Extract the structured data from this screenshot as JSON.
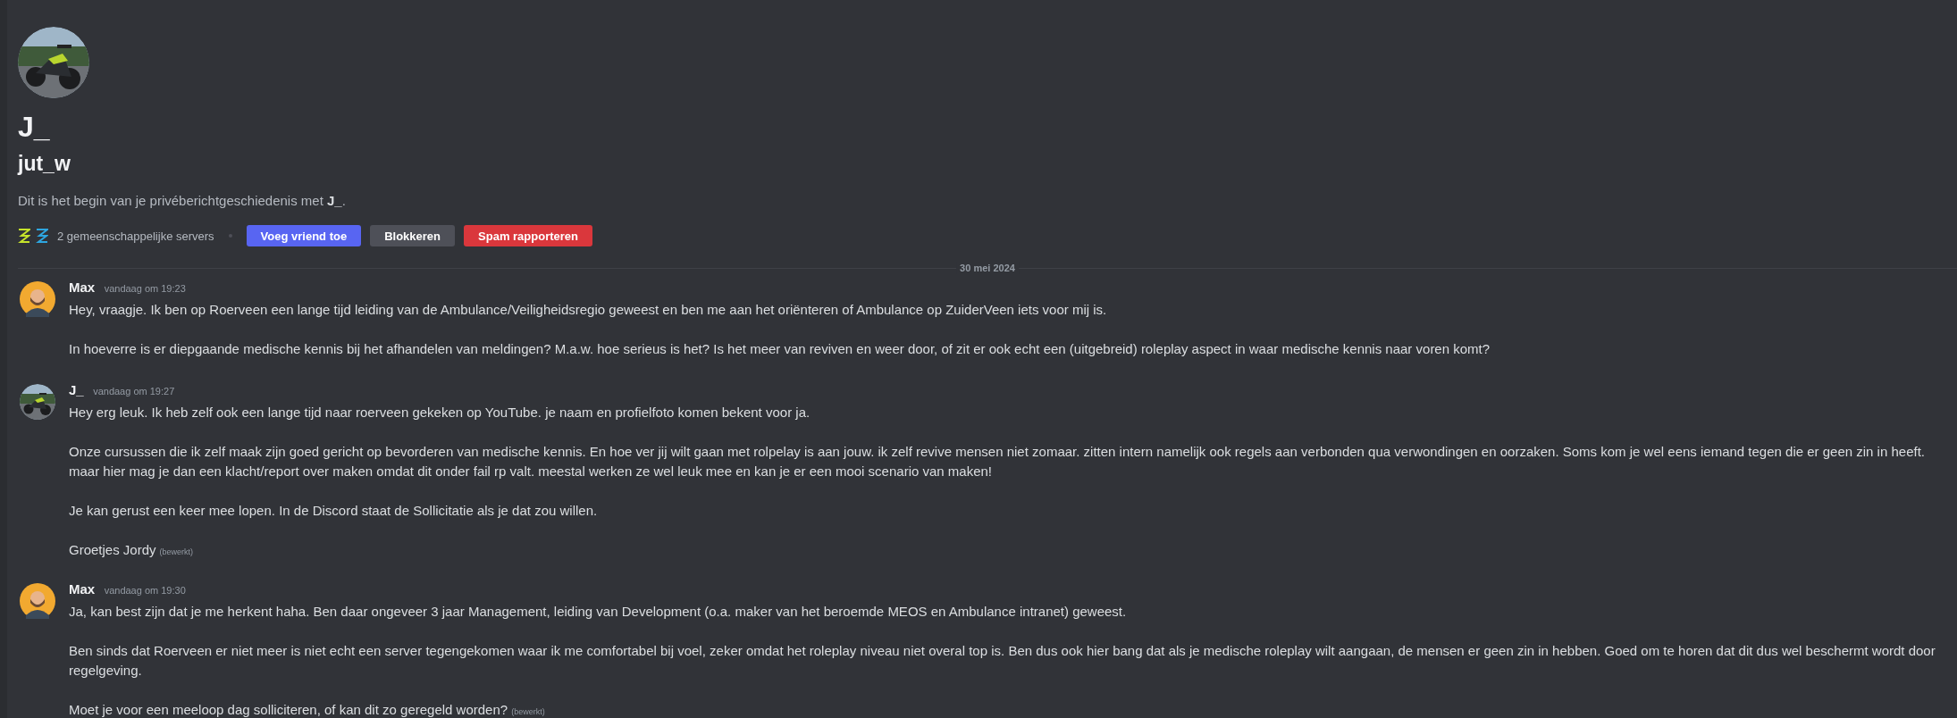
{
  "profile": {
    "display_name": "J_",
    "username": "jut_w",
    "intro": "Dit is het begin van je privéberichtgeschiedenis met **J_**.",
    "server_icons": [
      {
        "color": "#c6e32b"
      },
      {
        "color": "#2ea6e0"
      }
    ],
    "mutual_servers": "2 gemeenschappelijke servers",
    "buttons": [
      {
        "label": "Voeg vriend toe",
        "kind": "primary"
      },
      {
        "label": "Blokkeren",
        "kind": "secondary"
      },
      {
        "label": "Spam rapporteren",
        "kind": "danger"
      }
    ]
  },
  "date_divider": "30 mei 2024",
  "messages": [
    {
      "author": "Max",
      "time": "vandaag om 19:23",
      "avatar": {
        "kind": "figure"
      },
      "paragraphs": [
        {
          "text": "Hey, vraagje. Ik ben op Roerveen een lange tijd leiding van de Ambulance/Veiligheidsregio geweest en ben me aan het oriënteren of Ambulance op ZuiderVeen iets voor mij is."
        },
        {
          "text": "In hoeverre is er diepgaande medische kennis bij het afhandelen van meldingen? M.a.w. hoe serieus is het? Is het meer van reviven en weer door, of zit er ook echt een (uitgebreid) roleplay aspect in waar medische kennis naar voren komt?"
        }
      ]
    },
    {
      "author": "J_",
      "time": "vandaag om 19:27",
      "paragraphs": [
        {
          "text": "Hey erg leuk. Ik heb zelf ook een lange tijd naar roerveen gekeken op YouTube. je naam en profielfoto komen bekent voor ja."
        },
        {
          "text": "Onze cursussen die ik zelf maak zijn goed gericht op bevorderen van medische kennis. En hoe ver jij wilt gaan met rolpelay is aan jouw. ik zelf revive mensen niet zomaar. zitten intern namelijk ook regels aan verbonden qua verwondingen en oorzaken. Soms kom je wel eens iemand tegen die er geen zin in heeft. maar hier mag je dan een klacht/report over maken omdat dit onder fail rp valt. meestal werken ze wel leuk mee en kan je er een mooi scenario van maken!"
        },
        {
          "text": "Je kan gerust een keer mee lopen. In de Discord staat de Sollicitatie als je dat zou willen."
        },
        {
          "text": "Groetjes Jordy",
          "edited": "(bewerkt)"
        }
      ]
    },
    {
      "author": "Max",
      "time": "vandaag om 19:30",
      "avatar": {
        "kind": "figure"
      },
      "paragraphs": [
        {
          "text": "Ja, kan best zijn dat je me herkent haha. Ben daar ongeveer 3 jaar Management, leiding van Development (o.a. maker van het beroemde MEOS en Ambulance intranet) geweest."
        },
        {
          "text": "Ben sinds dat Roerveen er niet meer is niet echt een server tegengekomen waar ik me comfortabel bij voel, zeker omdat het roleplay niveau niet overal top is. Ben dus ook hier bang dat als je medische roleplay wilt aangaan, de mensen er geen zin in hebben. Goed om te horen dat dit dus wel beschermt wordt door regelgeving."
        },
        {
          "text": "Moet je voor een meeloop dag solliciteren, of kan dit zo geregeld worden?",
          "edited": "(bewerkt)"
        }
      ]
    }
  ]
}
